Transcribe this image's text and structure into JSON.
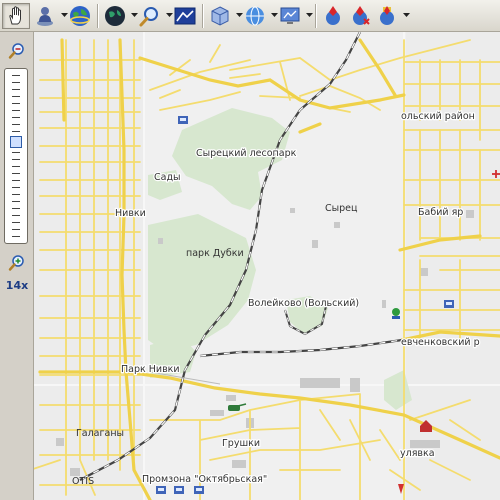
{
  "toolbar": {
    "items": [
      {
        "name": "pan-tool",
        "icon": "hand-icon"
      },
      {
        "name": "user-location",
        "icon": "person-pin-icon"
      },
      {
        "name": "globe",
        "icon": "globe-icon"
      },
      {
        "name": "dark-globe",
        "icon": "dark-globe-icon"
      },
      {
        "name": "zoom",
        "icon": "magnifier-icon"
      },
      {
        "name": "map-view",
        "icon": "map-window-icon"
      },
      {
        "name": "layers",
        "icon": "cube-icon"
      },
      {
        "name": "network",
        "icon": "network-globe-icon"
      },
      {
        "name": "settings",
        "icon": "monitor-icon"
      },
      {
        "name": "route-start",
        "icon": "pin-globe-icon"
      },
      {
        "name": "route-clear",
        "icon": "pin-x-icon"
      },
      {
        "name": "route-flag",
        "icon": "pin-flag-icon"
      }
    ]
  },
  "zoom": {
    "level_label": "14x",
    "level_fraction": 0.38
  },
  "map": {
    "labels": {
      "syretsky_forest_park": "Сырецкий лесопарк",
      "sady": "Сады",
      "nivki": "Нивки",
      "park_dubki": "парк Дубки",
      "syrets": "Сырец",
      "babiy_yar": "Бабий яр",
      "voleikovo": "Волейково (Вольский)",
      "podolsky_district": "ольский район",
      "shevchenkovsky_district": "евченковский р",
      "park_nivki": "Парк Нивки",
      "galagany": "Галаганы",
      "grushki": "Грушки",
      "promzona": "Промзона \"Октябрьская\"",
      "otis": "OTIS",
      "lukyanovka": "улявка"
    }
  }
}
